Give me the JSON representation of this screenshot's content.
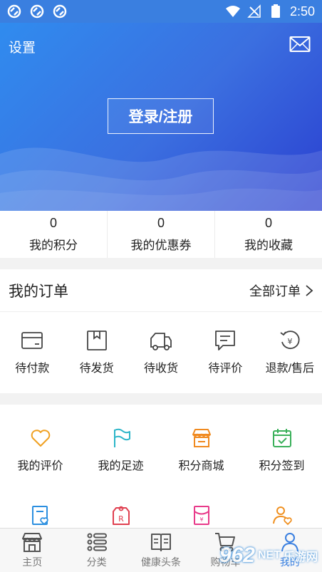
{
  "status_bar": {
    "time": "2:50",
    "battery": "2"
  },
  "header": {
    "settings_label": "设置",
    "login_label": "登录/注册"
  },
  "stats": [
    {
      "value": "0",
      "label": "我的积分"
    },
    {
      "value": "0",
      "label": "我的优惠券"
    },
    {
      "value": "0",
      "label": "我的收藏"
    }
  ],
  "orders": {
    "title": "我的订单",
    "all_label": "全部订单",
    "items": [
      {
        "label": "待付款",
        "icon": "wallet-icon"
      },
      {
        "label": "待发货",
        "icon": "package-icon"
      },
      {
        "label": "待收货",
        "icon": "truck-icon"
      },
      {
        "label": "待评价",
        "icon": "comment-icon"
      },
      {
        "label": "退款/售后",
        "icon": "refund-icon"
      }
    ]
  },
  "features": {
    "items": [
      {
        "label": "我的评价",
        "icon": "heart-icon",
        "color": "#f0a020"
      },
      {
        "label": "我的足迹",
        "icon": "flag-icon",
        "color": "#2bb5c8"
      },
      {
        "label": "积分商城",
        "icon": "store-icon",
        "color": "#f08a20"
      },
      {
        "label": "积分签到",
        "icon": "calendar-check-icon",
        "color": "#3ab05a"
      }
    ],
    "row2_icons": [
      {
        "icon": "doc-heart-icon",
        "color": "#2b8fe0"
      },
      {
        "icon": "tag-r-icon",
        "color": "#e04050"
      },
      {
        "icon": "envelope-yen-icon",
        "color": "#e83a8a"
      },
      {
        "icon": "user-heart-icon",
        "color": "#f09020"
      }
    ]
  },
  "tabbar": {
    "tabs": [
      {
        "label": "主页",
        "icon": "shop-icon"
      },
      {
        "label": "分类",
        "icon": "list-icon"
      },
      {
        "label": "健康头条",
        "icon": "book-icon"
      },
      {
        "label": "购物车",
        "icon": "cart-icon"
      },
      {
        "label": "我的",
        "icon": "user-icon"
      }
    ]
  },
  "watermark": {
    "number": "962",
    "suffix": "NET",
    "cn": "乐游网"
  }
}
